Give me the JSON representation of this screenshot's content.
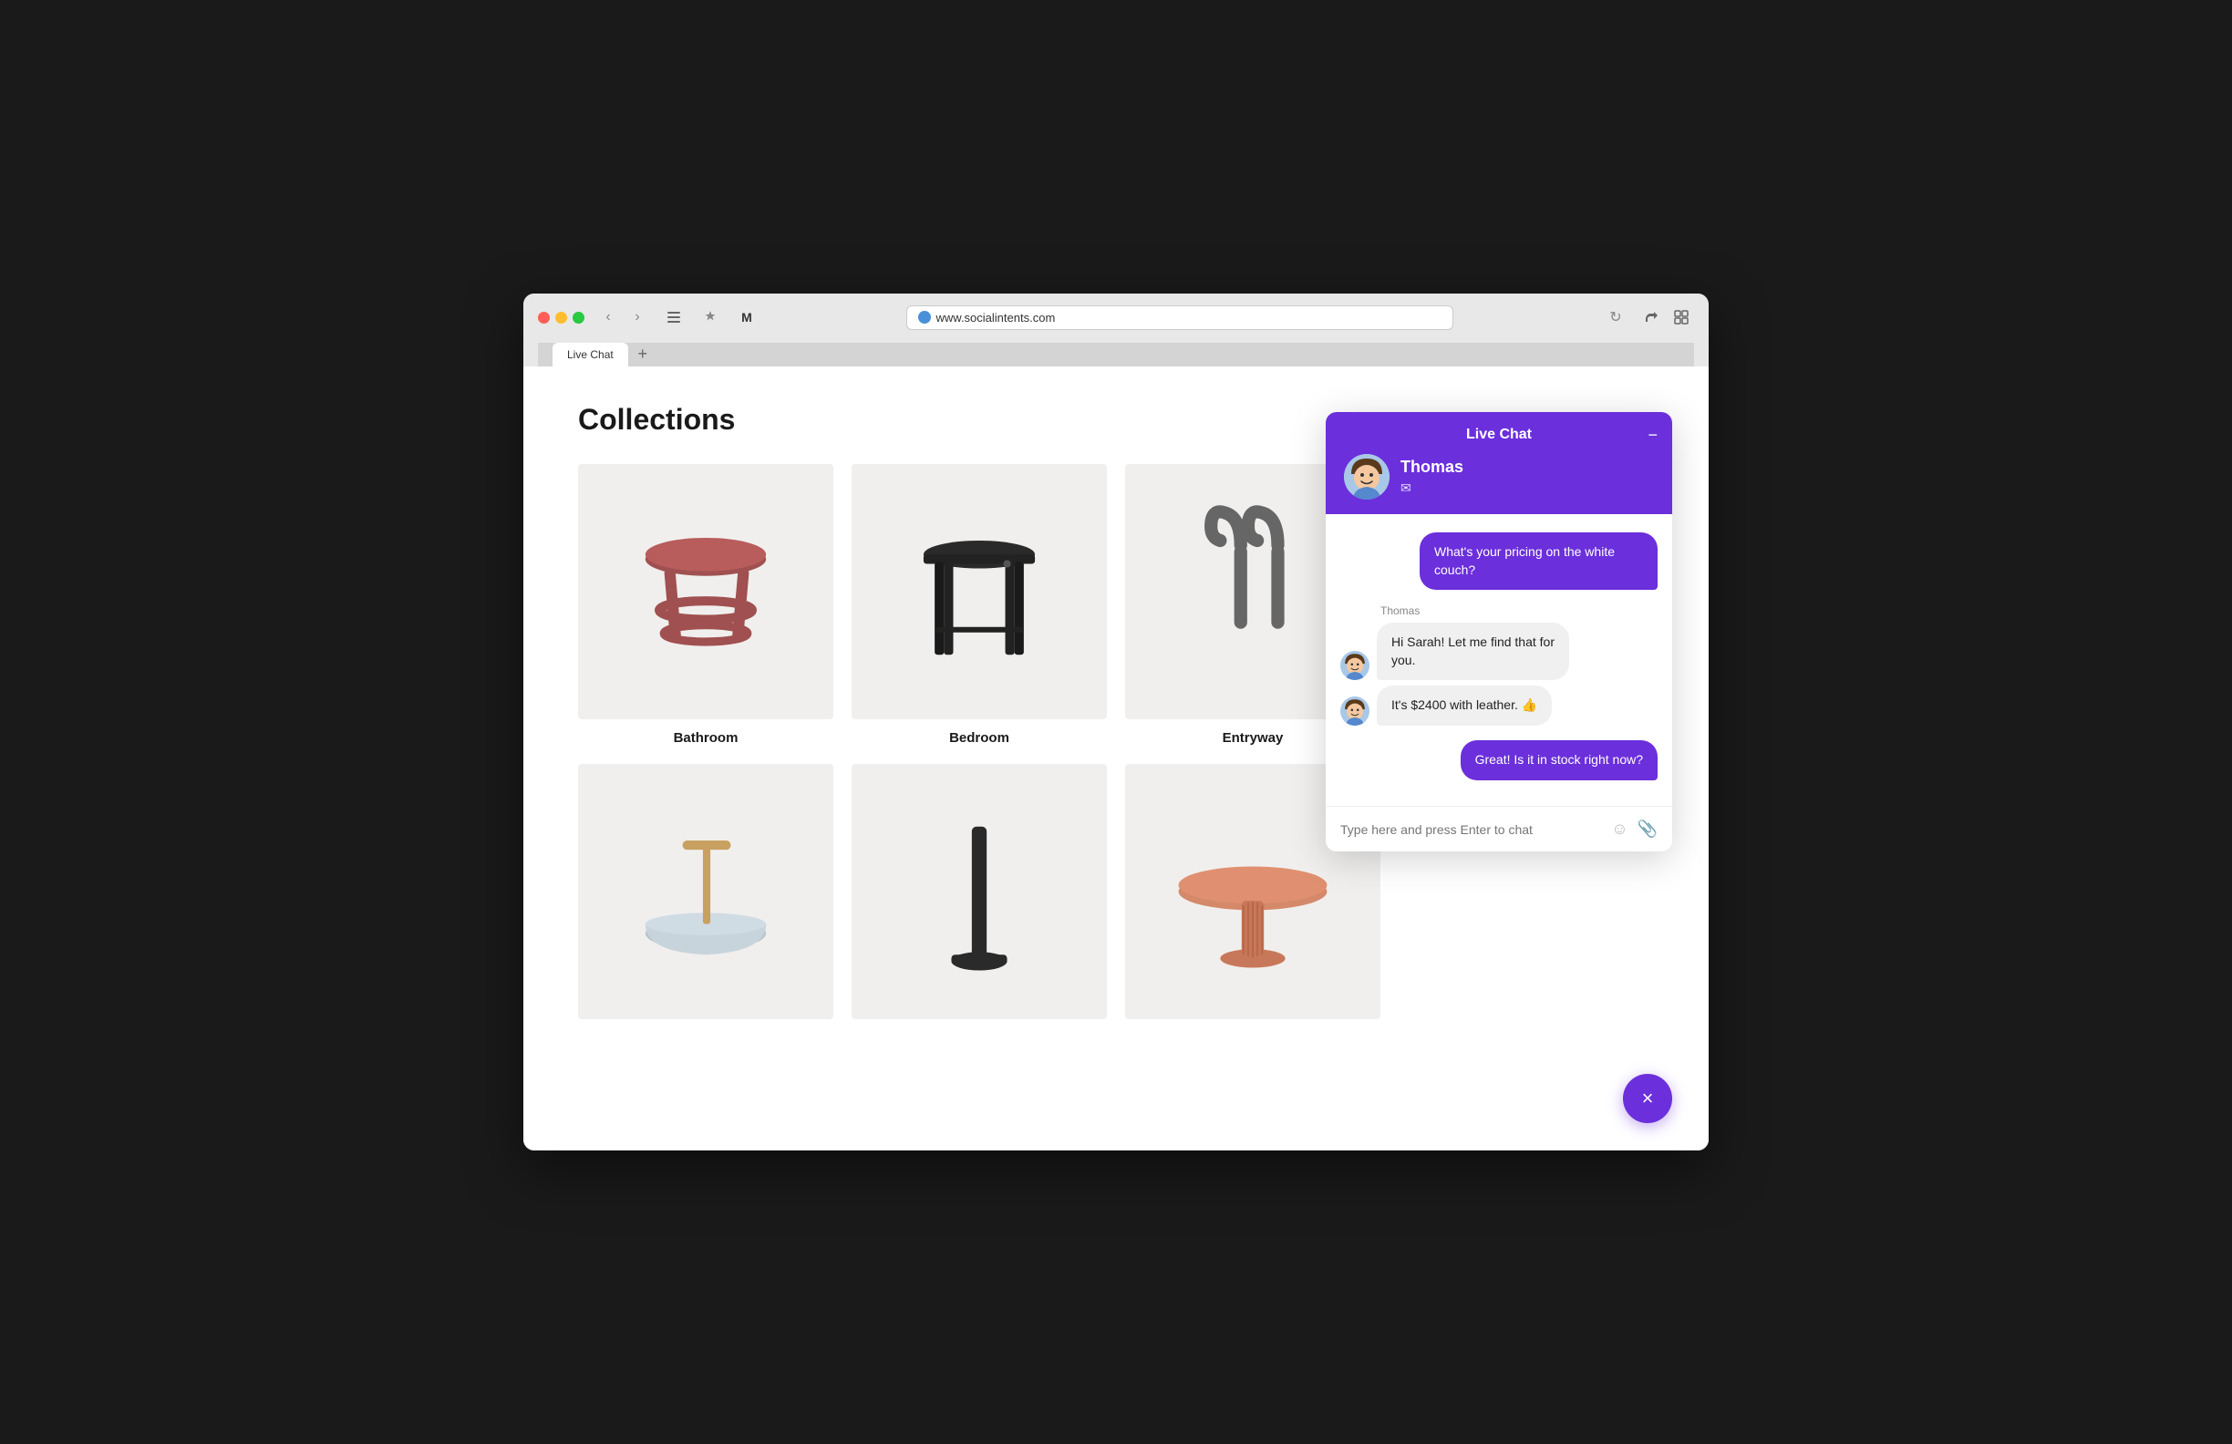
{
  "browser": {
    "tab_title": "Live Chat",
    "url": "www.socialintents.com",
    "new_tab_label": "+"
  },
  "page": {
    "collections_title": "Collections",
    "products": [
      {
        "id": "bathroom",
        "name": "Bathroom",
        "type": "stool-red"
      },
      {
        "id": "bedroom",
        "name": "Bedroom",
        "type": "stool-black"
      },
      {
        "id": "entryway",
        "name": "Entryway",
        "type": "hooks"
      },
      {
        "id": "bathroom2",
        "name": "",
        "type": "organizer"
      },
      {
        "id": "bedroom2",
        "name": "",
        "type": "pole"
      },
      {
        "id": "living",
        "name": "",
        "type": "table"
      }
    ]
  },
  "chat": {
    "title": "Live Chat",
    "agent_name": "Thomas",
    "minimize_label": "−",
    "close_label": "×",
    "messages": [
      {
        "id": 1,
        "type": "outgoing",
        "text": "What's your pricing on the white couch?"
      },
      {
        "id": 2,
        "type": "incoming-label",
        "text": "Thomas"
      },
      {
        "id": 3,
        "type": "incoming",
        "text": "Hi Sarah! Let me find that for you."
      },
      {
        "id": 4,
        "type": "incoming-no-avatar",
        "text": "It's $2400 with leather. 👍"
      },
      {
        "id": 5,
        "type": "outgoing",
        "text": "Great! Is it in stock right now?"
      }
    ],
    "input_placeholder": "Type here and press Enter to chat"
  }
}
